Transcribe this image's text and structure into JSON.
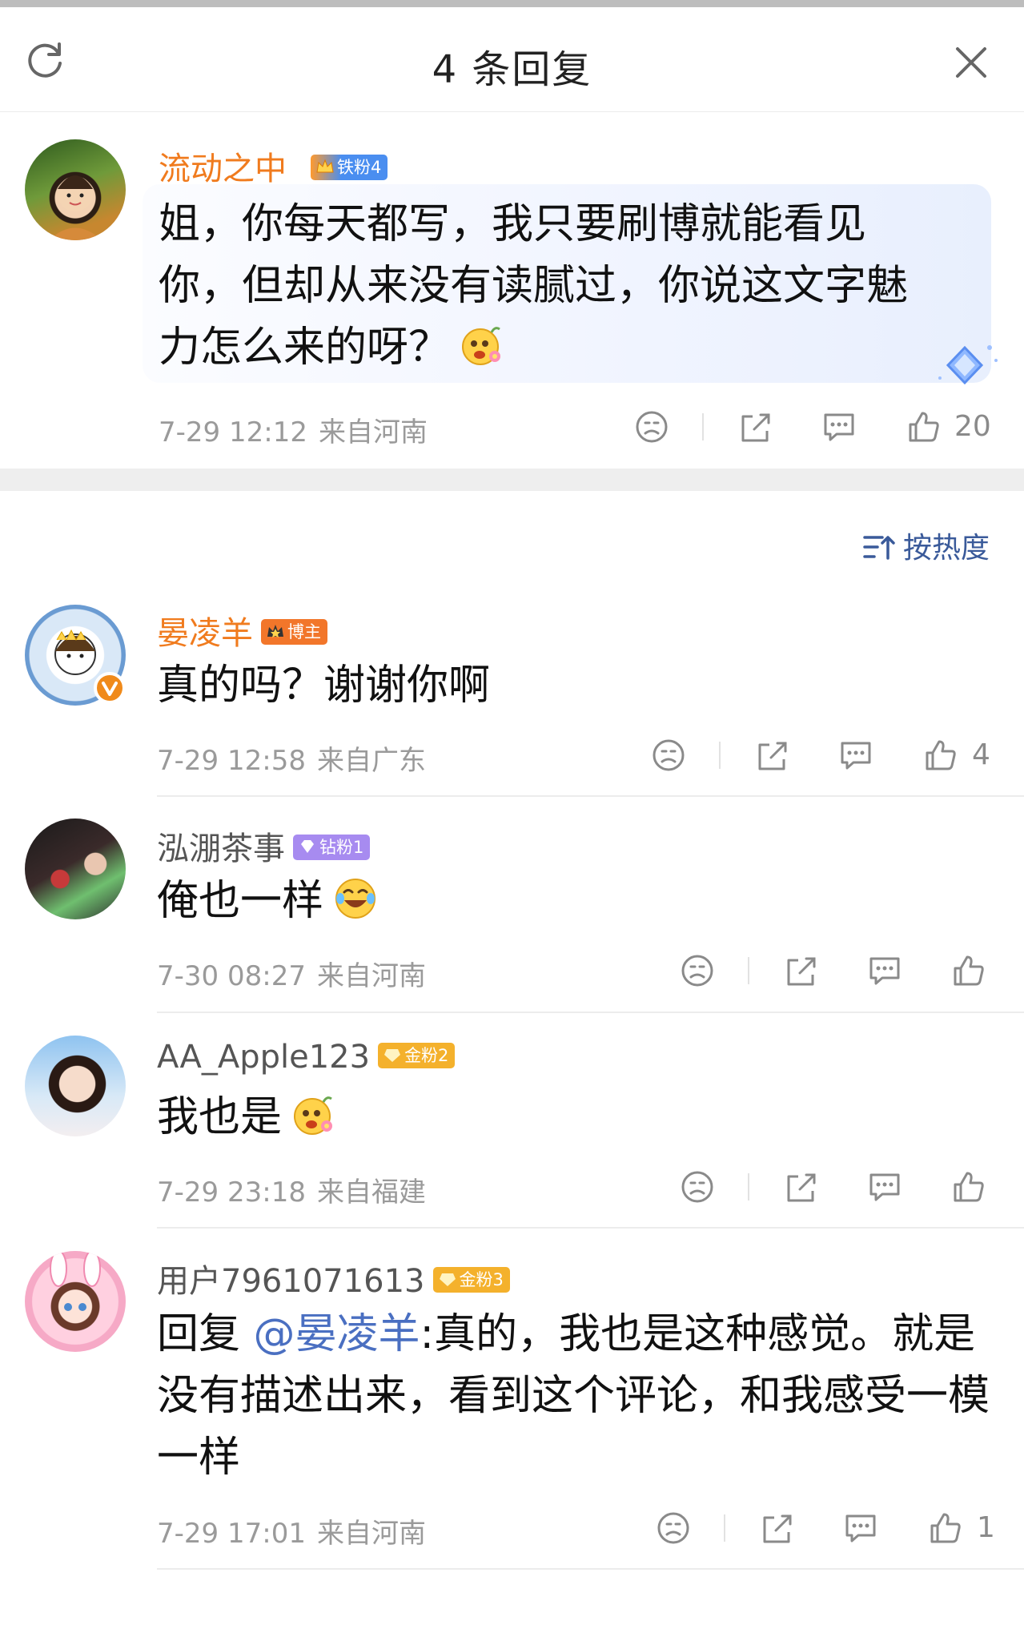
{
  "header": {
    "title": "4 条回复"
  },
  "root_comment": {
    "user": "流动之中_",
    "badge": "铁粉4",
    "text": "姐，你每天都写，我只要刷博就能看见你，但却从来没有读腻过，你说这文字魅力怎么来的呀？",
    "time": "7-29 12:12",
    "location": "来自河南",
    "likes": "20"
  },
  "sort": {
    "label": "按热度"
  },
  "replies": [
    {
      "user": "晏凌羊",
      "badge": "博主",
      "text": "真的吗？谢谢你啊",
      "time": "7-29 12:58",
      "location": "来自广东",
      "likes": "4"
    },
    {
      "user": "泓淜茶事",
      "badge": "钻粉1",
      "text": "俺也一样",
      "time": "7-30 08:27",
      "location": "来自河南",
      "likes": ""
    },
    {
      "user": "AA_Apple123",
      "badge": "金粉2",
      "text": "我也是",
      "time": "7-29 23:18",
      "location": "来自福建",
      "likes": ""
    },
    {
      "user": "用户7961071613",
      "badge": "金粉3",
      "reply_prefix": "回复 ",
      "mention": "@晏凌羊",
      "text": ":真的，我也是这种感觉。就是没有描述出来，看到这个评论，和我感受一模一样",
      "time": "7-29 17:01",
      "location": "来自河南",
      "likes": "1"
    }
  ],
  "colors": {
    "name_highlight": "#f07b1e",
    "mention": "#4a6fc1",
    "meta_gray": "#9a9a9a",
    "sort_blue": "#3a5a9a"
  }
}
